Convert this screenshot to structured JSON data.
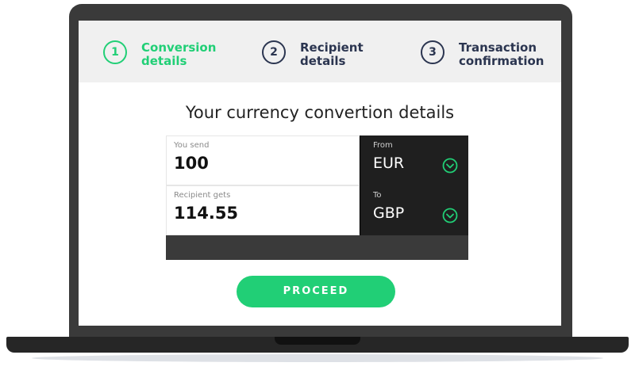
{
  "steps": [
    {
      "number": "1",
      "label": "Conversion\ndetails",
      "active": true
    },
    {
      "number": "2",
      "label": "Recipient\ndetails",
      "active": false
    },
    {
      "number": "3",
      "label": "Transaction\nconfirmation",
      "active": false
    }
  ],
  "heading": "Your currency convertion details",
  "form": {
    "send": {
      "label": "You send",
      "value": "100"
    },
    "from": {
      "label": "From",
      "currency": "EUR"
    },
    "gets": {
      "label": "Recipient gets",
      "value": "114.55"
    },
    "to": {
      "label": "To",
      "currency": "GBP"
    }
  },
  "proceed_label": "PROCEED",
  "colors": {
    "accent": "#21cf76",
    "dark": "#2b3550",
    "panel": "#1f1f1f"
  },
  "icons": {
    "dropdown": "chevron-down-circle-icon"
  }
}
